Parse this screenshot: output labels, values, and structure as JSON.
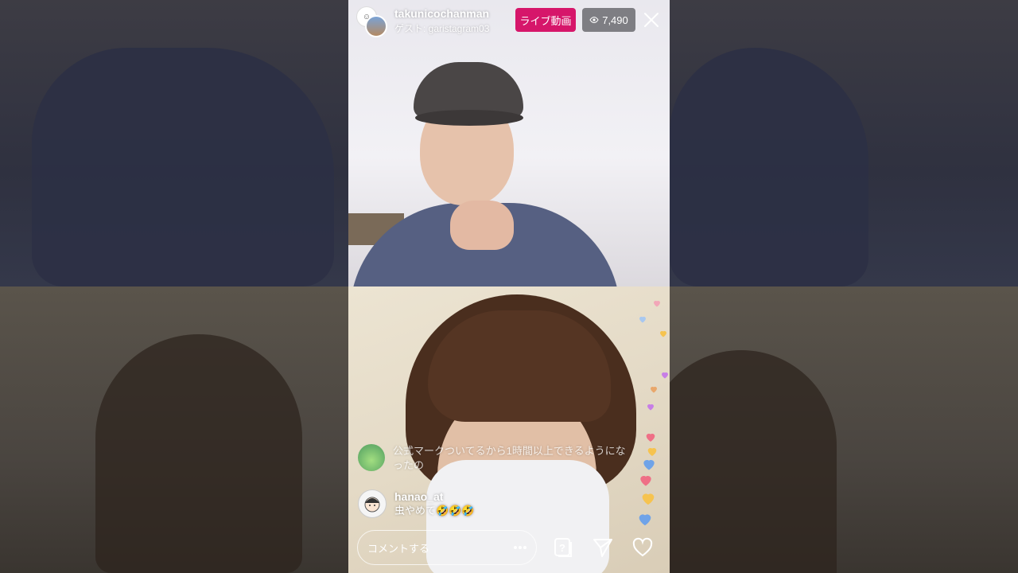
{
  "host": {
    "username": "takunicochanman",
    "guest_line": "ゲスト: garistagram03"
  },
  "badges": {
    "live_label": "ライブ動画",
    "viewer_count": "7,490"
  },
  "comments": [
    {
      "username": "",
      "text": "公式マークついてるから1時間以上できるようになったの"
    },
    {
      "username": "hanao_at",
      "text": "虫やめて🤣🤣🤣"
    }
  ],
  "composer": {
    "placeholder": "コメントする"
  },
  "icons": {
    "close": "close-icon",
    "eye": "eye-icon",
    "more": "more-dots-icon",
    "question": "question-box-icon",
    "send": "send-icon",
    "heart": "heart-icon"
  },
  "colors": {
    "live_badge": "#d6166a",
    "viewer_badge": "#5a5a5f"
  }
}
